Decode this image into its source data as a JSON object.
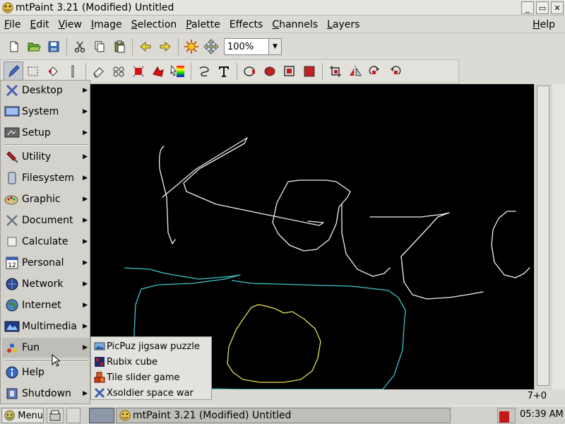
{
  "window": {
    "title": "mtPaint 3.21 (Modified) Untitled",
    "buttons": [
      "_",
      "▭",
      "✕"
    ]
  },
  "menubar": {
    "items": [
      {
        "label": "File",
        "mn": "F",
        "rest": "ile"
      },
      {
        "label": "Edit",
        "mn": "E",
        "rest": "dit"
      },
      {
        "label": "View",
        "mn": "V",
        "rest": "iew"
      },
      {
        "label": "Image",
        "mn": "I",
        "rest": "mage"
      },
      {
        "label": "Selection",
        "mn": "S",
        "rest": "election"
      },
      {
        "label": "Palette",
        "mn": "P",
        "rest": "alette"
      },
      {
        "label": "Effects",
        "mn": "",
        "rest": "Effects"
      },
      {
        "label": "Channels",
        "mn": "C",
        "rest": "hannels"
      },
      {
        "label": "Layers",
        "mn": "L",
        "rest": "ayers"
      }
    ],
    "help": {
      "mn": "H",
      "rest": "elp"
    }
  },
  "toolbar": {
    "zoom": "100%",
    "zoom_arrow": "▼",
    "buttons": [
      "new-icon",
      "open-icon",
      "save-icon",
      "cut-icon",
      "copy-icon",
      "paste-icon",
      "undo-icon",
      "redo-icon",
      "brightness-icon",
      "pan-icon"
    ]
  },
  "tools": [
    "paint-icon",
    "select-icon",
    "flood-fill-icon",
    "line-icon",
    "eraser-icon",
    "clone-icon",
    "polygon-select-icon",
    "lasso-icon",
    "gradient-icon",
    "smudge-icon",
    "text-icon",
    "ellipse-outline-icon",
    "ellipse-fill-icon",
    "rect-outline-icon",
    "rect-fill-icon",
    "crop-icon",
    "flip-icon",
    "rotate-cw-icon",
    "rotate-ccw-icon"
  ],
  "statusbar": {
    "text": "7+0"
  },
  "start_menu": {
    "items": [
      {
        "label": "Desktop",
        "icon": "desktop-icon"
      },
      {
        "label": "System",
        "icon": "system-icon"
      },
      {
        "label": "Setup",
        "icon": "setup-icon"
      },
      {
        "label": "Utility",
        "icon": "utility-icon"
      },
      {
        "label": "Filesystem",
        "icon": "filesystem-icon"
      },
      {
        "label": "Graphic",
        "icon": "graphic-icon"
      },
      {
        "label": "Document",
        "icon": "document-icon"
      },
      {
        "label": "Calculate",
        "icon": "calculate-icon"
      },
      {
        "label": "Personal",
        "icon": "personal-icon",
        "badge": "12"
      },
      {
        "label": "Network",
        "icon": "network-icon"
      },
      {
        "label": "Internet",
        "icon": "internet-icon"
      },
      {
        "label": "Multimedia",
        "icon": "multimedia-icon"
      },
      {
        "label": "Fun",
        "icon": "fun-icon"
      },
      {
        "label": "Help",
        "icon": "help-icon"
      },
      {
        "label": "Shutdown",
        "icon": "shutdown-icon"
      }
    ],
    "arrow": "▶"
  },
  "fun_submenu": {
    "items": [
      {
        "label": "PicPuz jigsaw puzzle",
        "icon": "picpuz-icon"
      },
      {
        "label": "Rubix cube",
        "icon": "rubix-icon"
      },
      {
        "label": "Tile slider game",
        "icon": "tile-slider-icon"
      },
      {
        "label": "Xsoldier space war",
        "icon": "xsoldier-icon"
      }
    ]
  },
  "taskbar": {
    "menu_label": "Menu",
    "task_label": "mtPaint 3.21 (Modified) Untitled",
    "clock": "05:39 AM"
  },
  "colors": {
    "canvas_bg": "#000000",
    "stroke_white": "#f2f2f2",
    "stroke_cyan": "#3fc4c8",
    "stroke_yellow": "#e6e05a",
    "tray_red": "#c61818"
  }
}
